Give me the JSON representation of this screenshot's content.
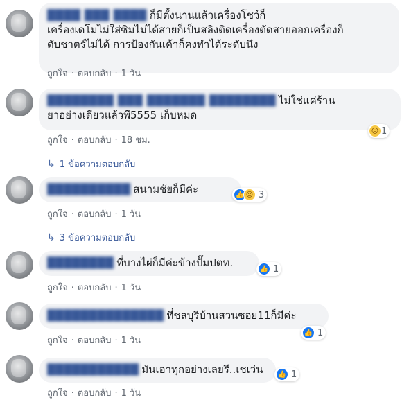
{
  "comments": [
    {
      "author": "████ ███ ████",
      "text_line1": "ก็มีตั้งนานแล้วเครื่องโชว์ก็",
      "text_line2": "เครื่องเดโมไม่ใส่ซิมไม่ได้สายก็เป็นสลิงติดเครื่องตัดสายออกเครื่องก็",
      "text_line3": "ดับชาตร์ไม่ได้ การป้องกันเค้าก็คงทำได้ระดับนึง",
      "like_label": "ถูกใจ",
      "reply_label": "ตอบกลับ",
      "time": "1 วัน"
    },
    {
      "author": "████████ ███ ███████ ████████",
      "text_line1": "ไม่ใช่แค่ร้าน",
      "text_line2": "ยาอย่างเดียวแล้วพี5555 เก็บหมด",
      "like_label": "ถูกใจ",
      "reply_label": "ตอบกลับ",
      "time": "18 ชม.",
      "reaction_icon": "wow-icon",
      "reaction_count": "1",
      "replies_label": "1 ข้อความตอบกลับ"
    },
    {
      "author": "██████████",
      "text": "สนามชัยก็มีค่ะ",
      "like_label": "ถูกใจ",
      "reply_label": "ตอบกลับ",
      "time": "1 วัน",
      "reaction_icon": "like-haha-icon",
      "reaction_count": "3",
      "replies_label": "3 ข้อความตอบกลับ"
    },
    {
      "author": "████████",
      "text": "ที่บางไผ่ก็มีค่ะข้างปั๊มปตท.",
      "like_label": "ถูกใจ",
      "reply_label": "ตอบกลับ",
      "time": "1 วัน",
      "reaction_icon": "like-icon",
      "reaction_count": "1"
    },
    {
      "author": "██████████████",
      "text": "ที่ชลบุรีบ้านสวนซอย11ก็มีค่ะ",
      "like_label": "ถูกใจ",
      "reply_label": "ตอบกลับ",
      "time": "1 วัน",
      "reaction_icon": "like-icon",
      "reaction_count": "1"
    },
    {
      "author": "███████████",
      "text": "มันเอาทุกอย่างเลยรึ..เชเว่น",
      "like_label": "ถูกใจ",
      "reply_label": "ตอบกลับ",
      "time": "1 วัน",
      "reaction_icon": "like-icon",
      "reaction_count": "1"
    }
  ],
  "colors": {
    "bubble": "#f2f3f5",
    "link": "#385898",
    "meta": "#606770",
    "like": "#1877f2"
  }
}
